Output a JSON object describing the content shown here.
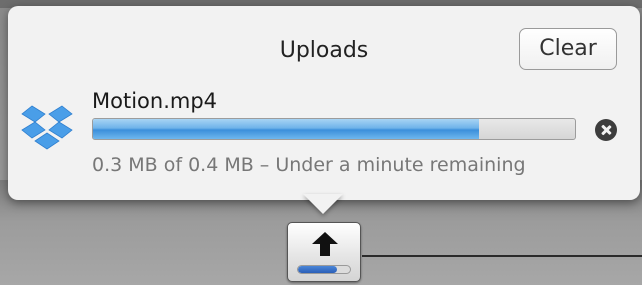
{
  "popover": {
    "title": "Uploads",
    "clear_label": "Clear"
  },
  "upload": {
    "file_name": "Motion.mp4",
    "status": "0.3 MB of 0.4 MB – Under a minute remaining",
    "progress_percent": 80,
    "icon": "dropbox-icon"
  },
  "toolbar": {
    "upload_button_icon": "upload-arrow-icon",
    "upload_progress_percent": 75
  },
  "colors": {
    "progress_blue": "#3b8fdb",
    "popover_bg": "#f2f2f2"
  }
}
